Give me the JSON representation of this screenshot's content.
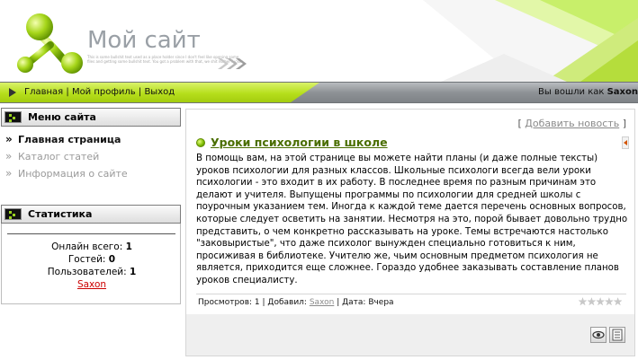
{
  "header": {
    "site_title": "Мой сайт",
    "tagline": "This is some bullshit text used as a place holder since I don't feel like opening some files and getting some bullshit text. You got a problem with that, we shit nother fucker"
  },
  "nav": {
    "links": [
      "Главная",
      "Мой профиль",
      "Выход"
    ],
    "separator": " | ",
    "user_prefix": "Вы вошли как",
    "username": "Saxon"
  },
  "sidebar": {
    "menu_title": "Меню сайта",
    "menu_items": [
      {
        "label": "Главная страница",
        "active": true
      },
      {
        "label": "Каталог статей",
        "active": false
      },
      {
        "label": "Информация о сайте",
        "active": false
      }
    ],
    "stats_title": "Статистика",
    "stats": {
      "online_label": "Онлайн всего:",
      "online_value": "1",
      "guests_label": "Гостей:",
      "guests_value": "0",
      "users_label": "Пользователей:",
      "users_value": "1",
      "user_name": "Saxon"
    }
  },
  "content": {
    "add_news_prefix": "[ ",
    "add_news_label": "Добавить новость",
    "add_news_suffix": " ]",
    "post": {
      "title": "Уроки психологии в школе",
      "text": "В помощь вам, на этой странице вы можете найти планы (и даже полные тексты) уроков психологии для разных классов. Школьные психологи всегда вели уроки психологии - это входит в их работу. В последнее время по разным причинам это делают и учителя. Выпущены программы по психологии для средней школы с поурочным указанием тем. Иногда к каждой теме дается перечень основных вопросов, которые следует осветить на занятии. Несмотря на это, порой бывает довольно трудно представить, о чем конкретно рассказывать на уроке. Темы встречаются настолько \"заковыристые\", что даже психолог вынужден специально готовиться к ним, просиживая в библиотеке. Учителю же, чьим основным предметом психология не является, приходится еще сложнее. Гораздо удобнее заказывать составление планов уроков специалисту.",
      "views_label": "Просмотров:",
      "views_value": "1",
      "added_label": "Добавил:",
      "author": "Saxon",
      "date_label": "Дата:",
      "date_value": "Вчера",
      "rating_stars": 5,
      "rating_value": 0
    }
  },
  "colors": {
    "accent_green": "#a3cc0e",
    "title_green": "#4a6e00",
    "link_red": "#cc0000"
  },
  "icons": [
    "logo-mark-icon",
    "header-arrows-icon",
    "menu-bullet-icon",
    "green-dot-icon",
    "scroll-arrow-icon",
    "star-icon",
    "view-icon",
    "print-icon"
  ]
}
